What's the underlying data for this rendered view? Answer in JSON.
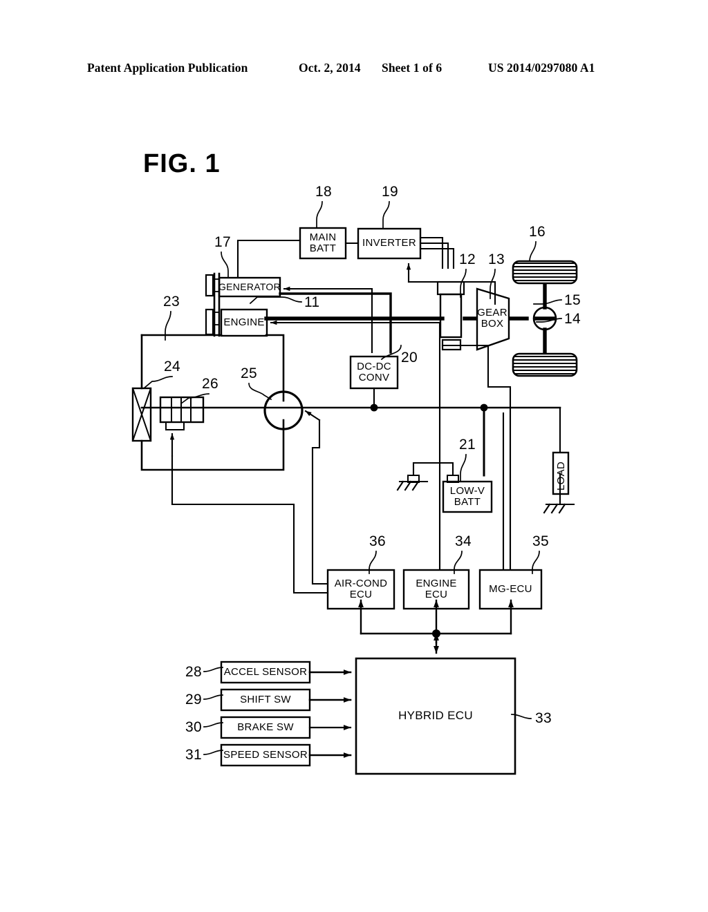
{
  "header": {
    "publication": "Patent Application Publication",
    "date": "Oct. 2, 2014",
    "sheet": "Sheet 1 of 6",
    "patent_number": "US 2014/0297080 A1"
  },
  "figure": {
    "title": "FIG. 1",
    "blocks": {
      "main_batt": "MAIN\nBATT",
      "inverter": "INVERTER",
      "generator": "GENERATOR",
      "engine": "ENGINE",
      "gear_box": "GEAR\nBOX",
      "dcdc_conv": "DC-DC\nCONV",
      "low_v_batt": "LOW-V\nBATT",
      "load": "LOAD",
      "air_cond_ecu": "AIR-COND\nECU",
      "engine_ecu": "ENGINE\nECU",
      "mg_ecu": "MG-ECU",
      "hybrid_ecu": "HYBRID ECU",
      "accel_sensor": "ACCEL SENSOR",
      "shift_sw": "SHIFT SW",
      "brake_sw": "BRAKE SW",
      "speed_sensor": "SPEED SENSOR"
    },
    "reference_numerals": {
      "n11": "11",
      "n12": "12",
      "n13": "13",
      "n14": "14",
      "n15": "15",
      "n16": "16",
      "n17": "17",
      "n18": "18",
      "n19": "19",
      "n20": "20",
      "n21": "21",
      "n23": "23",
      "n24": "24",
      "n25": "25",
      "n26": "26",
      "n28": "28",
      "n29": "29",
      "n30": "30",
      "n31": "31",
      "n33": "33",
      "n34": "34",
      "n35": "35",
      "n36": "36"
    }
  },
  "colors": {
    "ink": "#000000",
    "paper": "#ffffff"
  }
}
